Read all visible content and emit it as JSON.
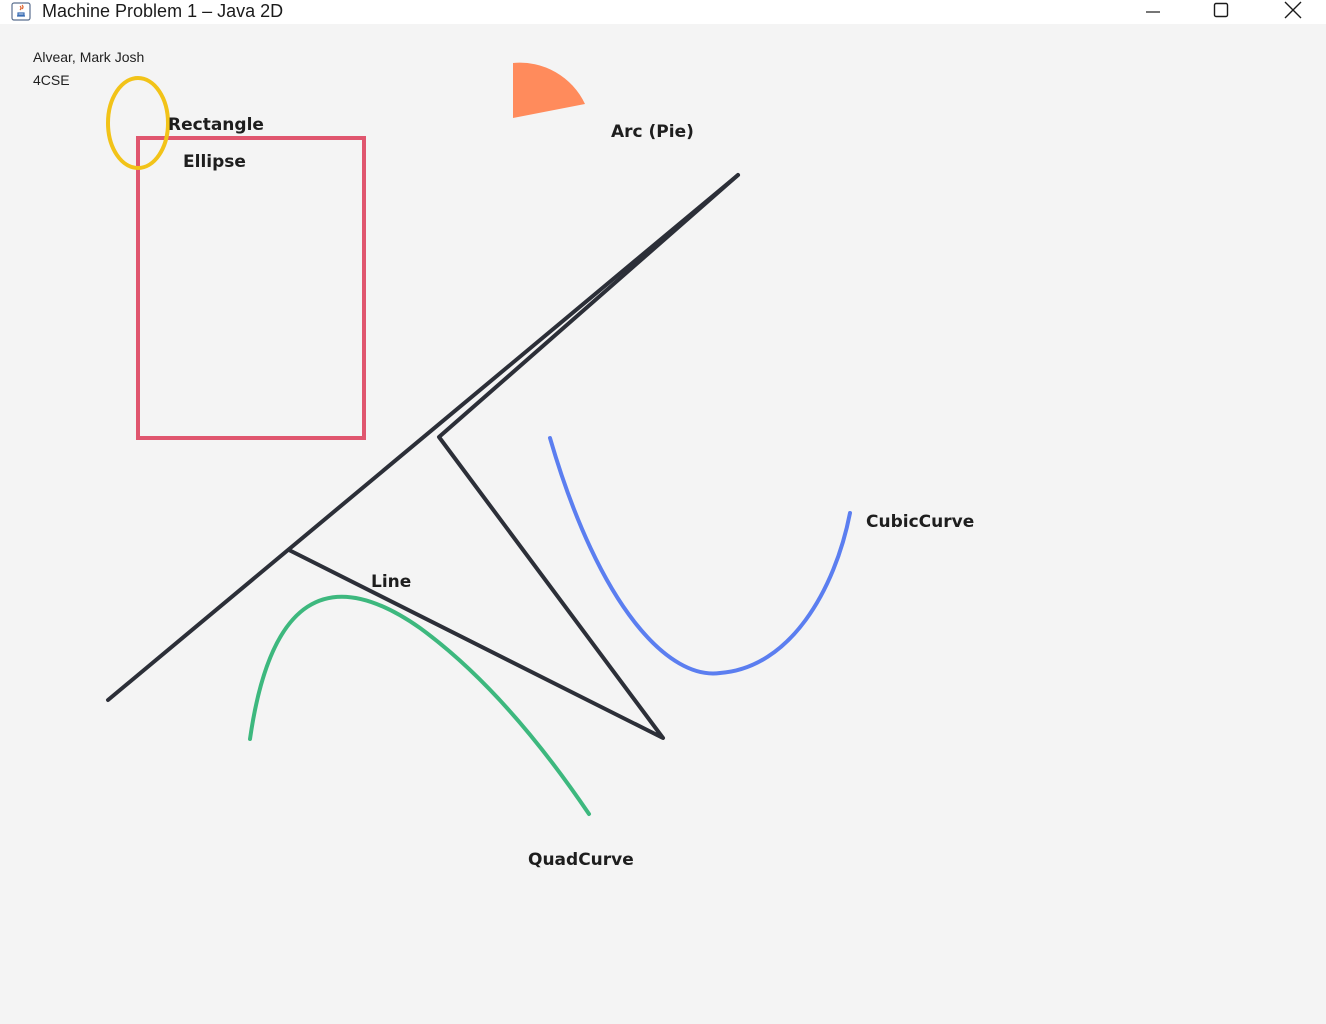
{
  "window": {
    "title": "Machine Problem 1 – Java 2D",
    "app_icon": "java-coffee-icon",
    "controls": {
      "minimize_icon": "minimize-icon",
      "maximize_icon": "maximize-icon",
      "close_icon": "close-icon"
    }
  },
  "author": {
    "name": "Alvear, Mark Josh",
    "section": "4CSE"
  },
  "shapes": {
    "rectangle": {
      "label": "Rectangle",
      "color": "#e0566e"
    },
    "ellipse": {
      "label": "Ellipse",
      "color": "#f2c318"
    },
    "arc": {
      "label": "Arc (Pie)",
      "color": "#ff8b5c"
    },
    "line": {
      "label": "Line",
      "color": "#2c2f38"
    },
    "cubic_curve": {
      "label": "CubicCurve",
      "color": "#5b7ef0"
    },
    "quad_curve": {
      "label": "QuadCurve",
      "color": "#3db87e"
    }
  }
}
